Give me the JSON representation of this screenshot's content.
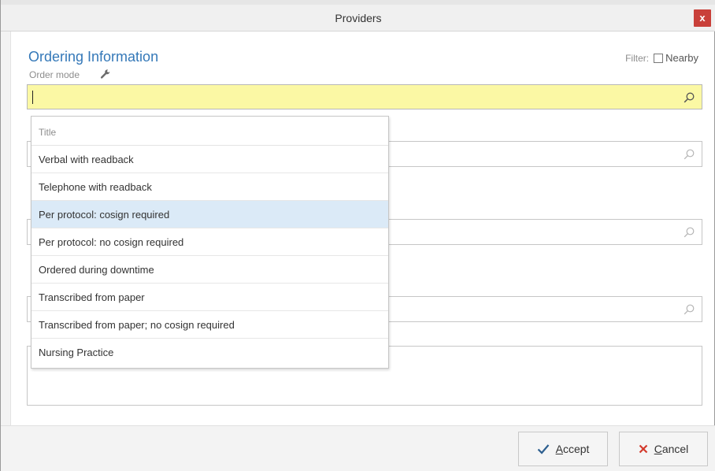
{
  "window": {
    "title": "Providers",
    "close_label": "x"
  },
  "ordering": {
    "section_title": "Ordering Information",
    "order_mode_label": "Order mode",
    "order_mode_value": "",
    "filter_label": "Filter:",
    "nearby_label": "Nearby",
    "nearby_checked": false
  },
  "dropdown": {
    "header": "Title",
    "selected_index": 2,
    "items": [
      "Verbal with readback",
      "Telephone with readback",
      "Per protocol: cosign required",
      "Per protocol: no cosign required",
      "Ordered during downtime",
      "Transcribed from paper",
      "Transcribed from paper; no cosign required",
      "Nursing Practice"
    ]
  },
  "footer": {
    "accept_first": "A",
    "accept_rest": "ccept",
    "cancel_first": "C",
    "cancel_rest": "ancel"
  },
  "colors": {
    "accent": "#3478b8",
    "field_active": "#fbf8a4",
    "selected_row": "#dbeaf7",
    "close_red": "#c9403a",
    "accept_check": "#2d5f8f",
    "cancel_x": "#d33a2c"
  },
  "icons": {
    "search": "magnifier-icon",
    "settings": "wrench-icon",
    "close": "close-icon",
    "accept": "checkmark-icon",
    "cancel": "x-icon"
  }
}
